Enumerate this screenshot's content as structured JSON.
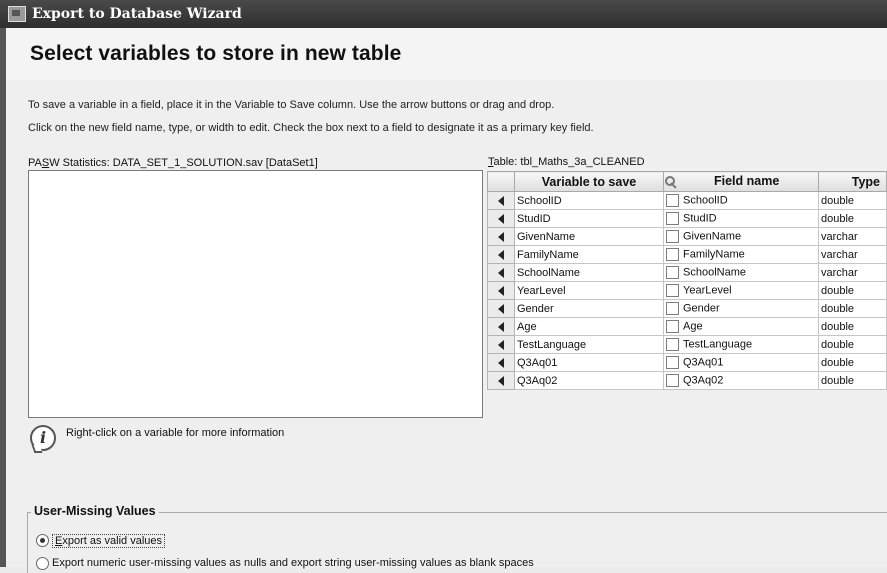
{
  "window": {
    "title": "Export to Database Wizard"
  },
  "page": {
    "title": "Select variables to store in new table",
    "instruction_1": "To save a variable in a field, place it in the Variable to Save column. Use the arrow buttons or drag and drop.",
    "instruction_2": "Click on the new field name, type, or width to edit. Check the box next to a field to designate it as a primary key field."
  },
  "source": {
    "label_prefix": "PA",
    "label_mnemonic": "S",
    "label_suffix": "W Statistics:  DATA_SET_1_SOLUTION.sav [DataSet1]"
  },
  "table": {
    "label_mnemonic": "T",
    "label_suffix": "able:  tbl_Maths_3a_CLEANED",
    "headers": {
      "variable": "Variable to save",
      "field": "Field name",
      "type": "Type"
    },
    "rows": [
      {
        "variable": "SchoolID",
        "field": "SchoolID",
        "type": "double"
      },
      {
        "variable": "StudID",
        "field": "StudID",
        "type": "double"
      },
      {
        "variable": "GivenName",
        "field": "GivenName",
        "type": "varchar"
      },
      {
        "variable": "FamilyName",
        "field": "FamilyName",
        "type": "varchar"
      },
      {
        "variable": "SchoolName",
        "field": "SchoolName",
        "type": "varchar"
      },
      {
        "variable": "YearLevel",
        "field": "YearLevel",
        "type": "double"
      },
      {
        "variable": "Gender",
        "field": "Gender",
        "type": "double"
      },
      {
        "variable": "Age",
        "field": "Age",
        "type": "double"
      },
      {
        "variable": "TestLanguage",
        "field": "TestLanguage",
        "type": "double"
      },
      {
        "variable": "Q3Aq01",
        "field": "Q3Aq01",
        "type": "double"
      },
      {
        "variable": "Q3Aq02",
        "field": "Q3Aq02",
        "type": "double"
      }
    ]
  },
  "info": {
    "text": "Right-click on a variable for more information"
  },
  "missing": {
    "legend": "User-Missing Values",
    "option1_mnemonic": "E",
    "option1_rest": "xport as valid values",
    "option2": "Export numeric user-missing values as nulls and export string user-missing values as blank spaces",
    "selected": "option1"
  }
}
